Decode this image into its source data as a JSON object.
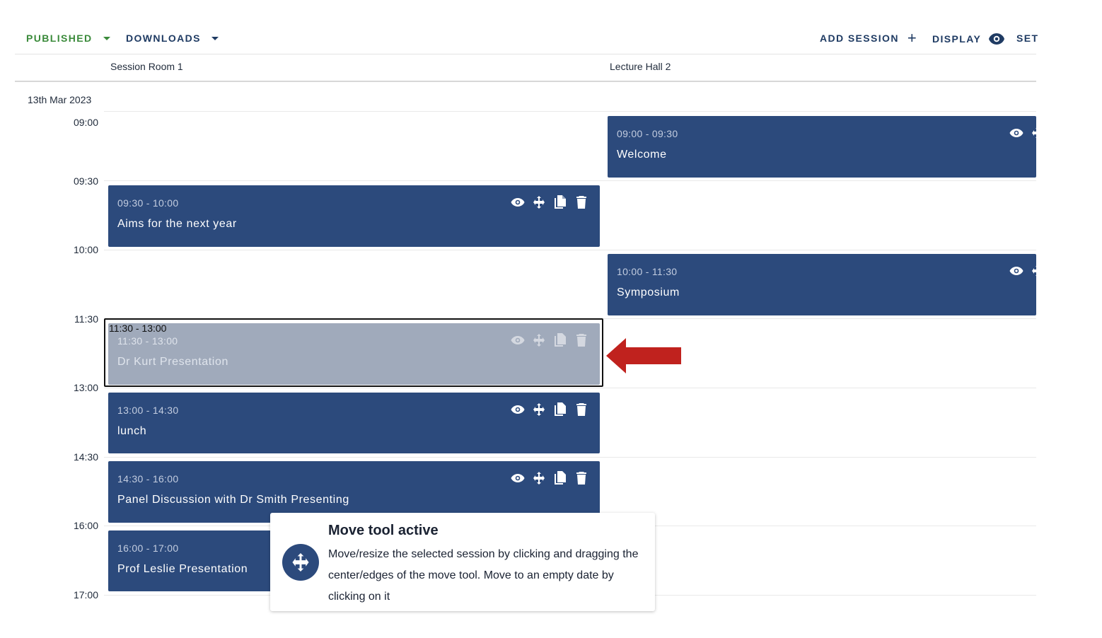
{
  "toolbar": {
    "published_label": "PUBLISHED",
    "downloads_label": "DOWNLOADS",
    "add_session_label": "ADD SESSION",
    "display_label": "DISPLAY",
    "settings_label": "SET",
    "published_color": "#3a8a3a",
    "accent_color": "#1f3b63"
  },
  "columns": [
    {
      "name": "Session Room 1"
    },
    {
      "name": "Lecture Hall 2"
    }
  ],
  "date": "13th Mar 2023",
  "times": [
    "09:00",
    "09:30",
    "10:00",
    "11:30",
    "13:00",
    "14:30",
    "16:00",
    "17:00"
  ],
  "sessions": [
    {
      "room": "Lecture Hall 2",
      "time": "09:00 - 09:30",
      "title": "Welcome"
    },
    {
      "room": "Session Room 1",
      "time": "09:30 - 10:00",
      "title": "Aims for the next year"
    },
    {
      "room": "Lecture Hall 2",
      "time": "10:00 - 11:30",
      "title": "Symposium"
    },
    {
      "room": "Session Room 1",
      "time": "11:30 - 13:00",
      "title": "Dr Kurt Presentation",
      "selected": true,
      "drag_time": "11:30 - 13:00"
    },
    {
      "room": "Session Room 1",
      "time": "13:00 - 14:30",
      "title": "lunch"
    },
    {
      "room": "Session Room 1",
      "time": "14:30 - 16:00",
      "title": "Panel Discussion with Dr Smith Presenting"
    },
    {
      "room": "Session Room 1",
      "time": "16:00 - 17:00",
      "title": "Prof Leslie Presentation"
    }
  ],
  "session_icons": [
    "eye-icon",
    "move-icon",
    "copy-icon",
    "delete-icon"
  ],
  "tooltip": {
    "title": "Move tool active",
    "body": "Move/resize the selected session by clicking and dragging the center/edges of the move tool. Move to an empty date by clicking on it"
  },
  "colors": {
    "session": "#2c4a7c",
    "session_ghost": "#a0aabb",
    "arrow": "#c0221e"
  }
}
